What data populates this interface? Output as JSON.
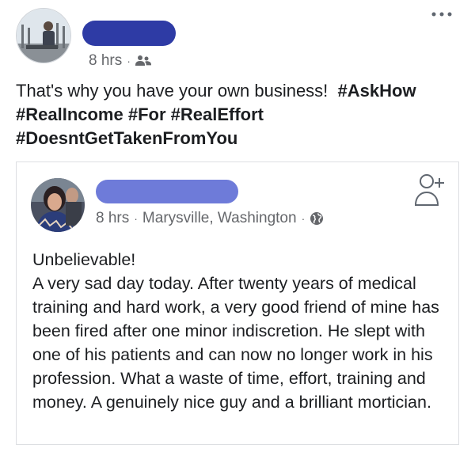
{
  "post": {
    "author": {
      "name_redacted": true,
      "redaction_color": "#2e3ba5"
    },
    "time": "8 hrs",
    "separator": "·",
    "audience_icon": "friends-icon",
    "more_icon": "more-horizontal-icon",
    "text_intro": "That's why you have your own business!",
    "hashtags_line1": "#AskHow",
    "hashtags_line2": "#RealIncome #For #RealEffort",
    "hashtags_line3": "#DoesntGetTakenFromYou"
  },
  "shared_post": {
    "author": {
      "name_redacted": true,
      "redaction_color": "#6e7bd9"
    },
    "time": "8 hrs",
    "separator": "·",
    "location": "Marysville, Washington",
    "audience_icon": "globe-icon",
    "add_friend_icon": "add-friend-icon",
    "text_line1": "Unbelievable!",
    "text_body": "A very sad day today. After twenty years of medical training and hard work, a very good friend of mine has been fired after one minor indiscretion. He slept with one of his patients and can now no longer work in his profession. What a waste of time, effort, training and money. A genuinely nice guy and a brilliant mortician."
  },
  "colors": {
    "meta_text": "#65676b",
    "body_text": "#1c1e21",
    "card_border": "#dddfe2"
  }
}
